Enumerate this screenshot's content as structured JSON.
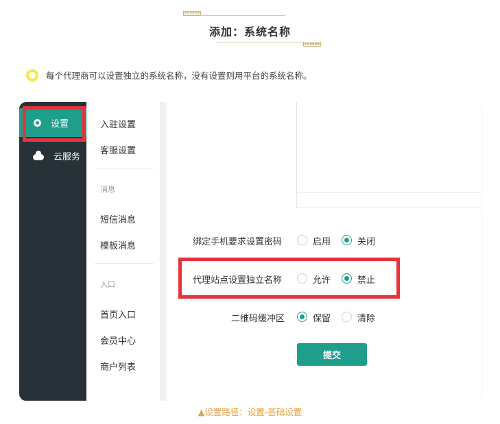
{
  "header": {
    "title": "添加：系统名称"
  },
  "note": {
    "text": "每个代理商可以设置独立的系统名称，没有设置则用平台的系统名称。"
  },
  "sidebar": {
    "items": [
      {
        "label": "设置",
        "icon": "gear-icon",
        "active": true
      },
      {
        "label": "云服务",
        "icon": "cloud-icon",
        "active": false
      }
    ]
  },
  "submenu": {
    "items": [
      "入驻设置",
      "客服设置"
    ],
    "groups": [
      {
        "title": "消息",
        "items": [
          "短信消息",
          "模板消息"
        ]
      },
      {
        "title": "入口",
        "items": [
          "首页入口",
          "会员中心",
          "商户列表"
        ]
      }
    ]
  },
  "form": {
    "rows": [
      {
        "label": "绑定手机要求设置密码",
        "options": [
          "启用",
          "关闭"
        ],
        "selected": 1
      },
      {
        "label": "代理站点设置独立名称",
        "options": [
          "允许",
          "禁止"
        ],
        "selected": 1
      },
      {
        "label": "二维码缓冲区",
        "options": [
          "保留",
          "清除"
        ],
        "selected": 0
      }
    ],
    "submit_label": "提交"
  },
  "caption": "▲设置路径：设置-基础设置",
  "colors": {
    "accent": "#1e9e8b",
    "sidebar_bg": "#263238",
    "highlight_red": "#e8323c",
    "caption": "#e6a33c"
  }
}
